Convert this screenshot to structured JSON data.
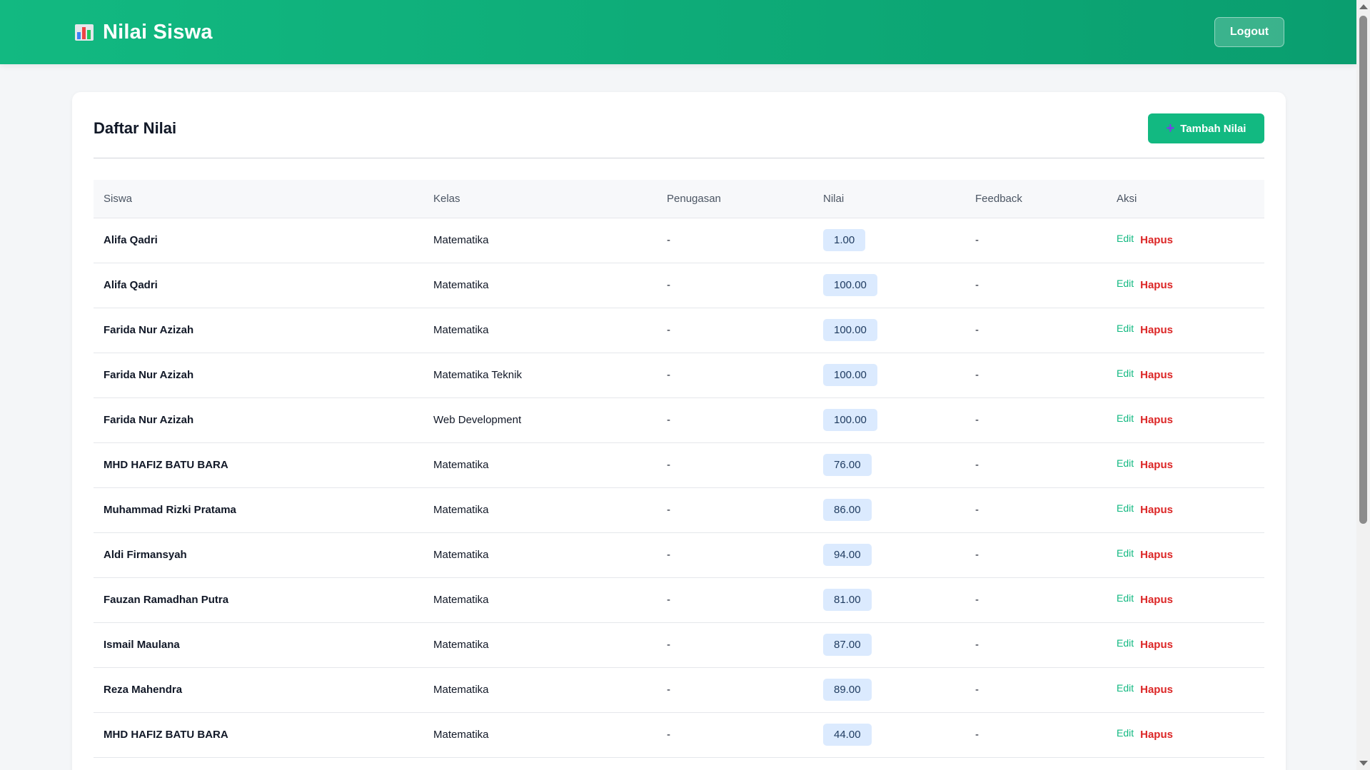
{
  "app": {
    "title": "Nilai Siswa",
    "logo_icon": "bar-chart-icon",
    "logout_label": "Logout",
    "brand_color": "#12b981"
  },
  "page": {
    "title": "Daftar Nilai",
    "add_button_label": "Tambah Nilai",
    "add_button_icon": "plus-icon"
  },
  "table": {
    "columns": [
      "Siswa",
      "Kelas",
      "Penugasan",
      "Nilai",
      "Feedback",
      "Aksi"
    ],
    "edit_label": "Edit",
    "delete_label": "Hapus",
    "rows": [
      {
        "student": "Alifa Qadri",
        "class": "Matematika",
        "assignment": "-",
        "score": "1.00",
        "feedback": "-"
      },
      {
        "student": "Alifa Qadri",
        "class": "Matematika",
        "assignment": "-",
        "score": "100.00",
        "feedback": "-"
      },
      {
        "student": "Farida Nur Azizah",
        "class": "Matematika",
        "assignment": "-",
        "score": "100.00",
        "feedback": "-"
      },
      {
        "student": "Farida Nur Azizah",
        "class": "Matematika Teknik",
        "assignment": "-",
        "score": "100.00",
        "feedback": "-"
      },
      {
        "student": "Farida Nur Azizah",
        "class": "Web Development",
        "assignment": "-",
        "score": "100.00",
        "feedback": "-"
      },
      {
        "student": "MHD HAFIZ BATU BARA",
        "class": "Matematika",
        "assignment": "-",
        "score": "76.00",
        "feedback": "-"
      },
      {
        "student": "Muhammad Rizki Pratama",
        "class": "Matematika",
        "assignment": "-",
        "score": "86.00",
        "feedback": "-"
      },
      {
        "student": "Aldi Firmansyah",
        "class": "Matematika",
        "assignment": "-",
        "score": "94.00",
        "feedback": "-"
      },
      {
        "student": "Fauzan Ramadhan Putra",
        "class": "Matematika",
        "assignment": "-",
        "score": "81.00",
        "feedback": "-"
      },
      {
        "student": "Ismail Maulana",
        "class": "Matematika",
        "assignment": "-",
        "score": "87.00",
        "feedback": "-"
      },
      {
        "student": "Reza Mahendra",
        "class": "Matematika",
        "assignment": "-",
        "score": "89.00",
        "feedback": "-"
      },
      {
        "student": "MHD HAFIZ BATU BARA",
        "class": "Matematika",
        "assignment": "-",
        "score": "44.00",
        "feedback": "-"
      }
    ]
  }
}
